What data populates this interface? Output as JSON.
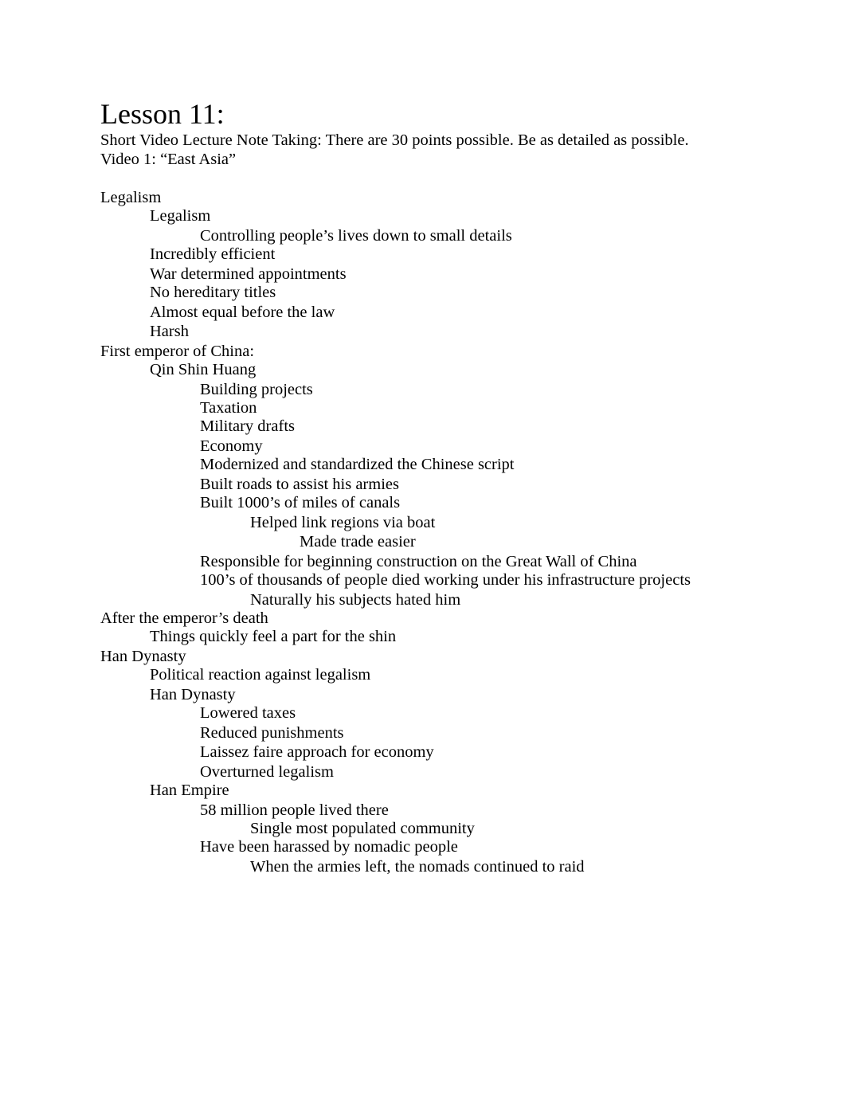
{
  "document": {
    "title": "Lesson 11:",
    "instructions": "Short Video Lecture Note Taking: There are 30 points possible. Be as detailed as possible.",
    "video_label": "Video 1: “East Asia”",
    "notes": [
      {
        "level": 0,
        "text": "Legalism"
      },
      {
        "level": 1,
        "text": "Legalism"
      },
      {
        "level": 2,
        "text": "Controlling people’s lives down to small details"
      },
      {
        "level": 1,
        "text": "Incredibly efficient"
      },
      {
        "level": 1,
        "text": "War determined appointments"
      },
      {
        "level": 1,
        "text": "No hereditary titles"
      },
      {
        "level": 1,
        "text": "Almost equal before the law"
      },
      {
        "level": 1,
        "text": "Harsh"
      },
      {
        "level": 0,
        "text": "First emperor of China:"
      },
      {
        "level": 1,
        "text": "Qin Shin Huang"
      },
      {
        "level": 2,
        "text": "Building projects"
      },
      {
        "level": 2,
        "text": "Taxation"
      },
      {
        "level": 2,
        "text": "Military drafts"
      },
      {
        "level": 2,
        "text": "Economy"
      },
      {
        "level": 2,
        "text": "Modernized and standardized the Chinese script"
      },
      {
        "level": 2,
        "text": "Built roads to assist his armies"
      },
      {
        "level": 2,
        "text": "Built 1000’s of miles of canals"
      },
      {
        "level": 3,
        "text": "Helped link regions via boat"
      },
      {
        "level": 4,
        "text": "Made trade easier"
      },
      {
        "level": 2,
        "text": "Responsible for beginning construction on the Great Wall of China"
      },
      {
        "level": 2,
        "text": "100’s of thousands of people died working under his infrastructure projects"
      },
      {
        "level": 3,
        "text": "Naturally his subjects hated him"
      },
      {
        "level": 0,
        "text": "After the emperor’s death"
      },
      {
        "level": 1,
        "text": "Things quickly feel a part for the shin"
      },
      {
        "level": 0,
        "text": "Han Dynasty"
      },
      {
        "level": 1,
        "text": "Political reaction against legalism"
      },
      {
        "level": 1,
        "text": "Han Dynasty"
      },
      {
        "level": 2,
        "text": "Lowered taxes"
      },
      {
        "level": 2,
        "text": "Reduced punishments"
      },
      {
        "level": 2,
        "text": "Laissez faire approach for economy"
      },
      {
        "level": 2,
        "text": "Overturned legalism"
      },
      {
        "level": 1,
        "text": "Han Empire"
      },
      {
        "level": 2,
        "text": "58 million people lived there"
      },
      {
        "level": 3,
        "text": "Single most populated community"
      },
      {
        "level": 2,
        "text": "Have been harassed by nomadic people"
      },
      {
        "level": 3,
        "text": "When the armies left, the nomads continued to raid"
      }
    ]
  }
}
